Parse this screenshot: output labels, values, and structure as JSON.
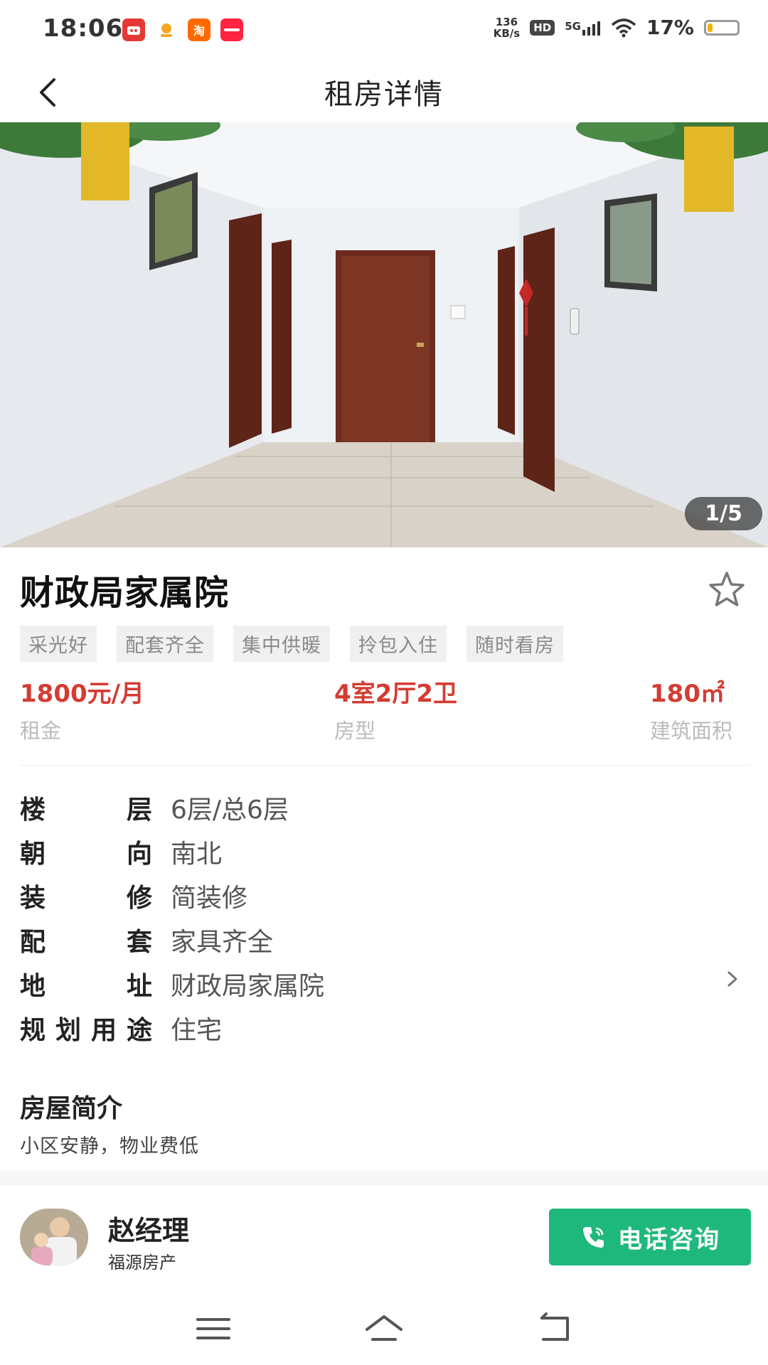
{
  "status_bar": {
    "time": "18:06",
    "app_icons": [
      {
        "name": "app-notification-icon",
        "text": "",
        "color": "#e53935"
      },
      {
        "name": "app-meituan-icon",
        "text": "",
        "color": "#f5a623"
      },
      {
        "name": "taobao-icon",
        "text": "淘",
        "color": "#ff6a00"
      },
      {
        "name": "xiaohongshu-icon",
        "text": "",
        "color": "#ff2442"
      }
    ],
    "network_speed_value": "136",
    "network_speed_unit": "KB/s",
    "hd_label": "HD",
    "network_type": "5G",
    "battery_percent": "17%",
    "battery_level": 0.17
  },
  "nav": {
    "title": "租房详情"
  },
  "gallery": {
    "counter": "1/5",
    "current": 1,
    "total": 5
  },
  "listing": {
    "title": "财政局家属院",
    "tags": [
      "采光好",
      "配套齐全",
      "集中供暖",
      "拎包入住",
      "随时看房"
    ],
    "stats": [
      {
        "value": "1800元/月",
        "label": "租金"
      },
      {
        "value": "4室2厅2卫",
        "label": "房型"
      },
      {
        "value": "180㎡",
        "label": "建筑面积"
      }
    ],
    "attributes": [
      {
        "label": "楼层",
        "value": "6层/总6层"
      },
      {
        "label": "朝向",
        "value": "南北"
      },
      {
        "label": "装修",
        "value": "简装修"
      },
      {
        "label": "配套",
        "value": "家具齐全"
      },
      {
        "label": "地址",
        "value": "财政局家属院"
      },
      {
        "label": "规划用途",
        "value": "住宅"
      }
    ],
    "intro_title": "房屋简介",
    "intro_text": "小区安静，物业费低"
  },
  "agent": {
    "name": "赵经理",
    "company": "福源房产",
    "call_label": "电话咨询"
  },
  "colors": {
    "accent_red": "#d43c33",
    "call_green": "#1fb87c"
  },
  "system_nav": [
    "menu-icon",
    "home-icon",
    "back-icon"
  ]
}
